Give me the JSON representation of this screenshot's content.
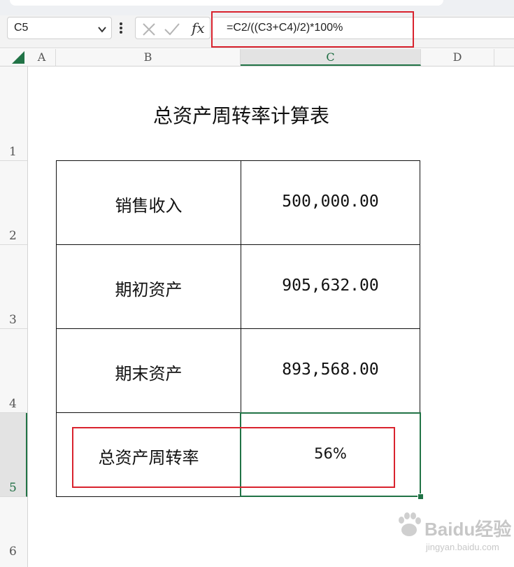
{
  "formula_bar": {
    "name_box": "C5",
    "fx_label": "fx",
    "formula": "=C2/((C3+C4)/2)*100%"
  },
  "columns": [
    "A",
    "B",
    "C",
    "D"
  ],
  "rows": [
    "1",
    "2",
    "3",
    "4",
    "5",
    "6"
  ],
  "sheet": {
    "title": "总资产周转率计算表",
    "table": [
      {
        "label": "销售收入",
        "value": "500,000.00"
      },
      {
        "label": "期初资产",
        "value": "905,632.00"
      },
      {
        "label": "期末资产",
        "value": "893,568.00"
      },
      {
        "label": "总资产周转率",
        "value": "56%"
      }
    ]
  },
  "watermark": {
    "brand": "Baidu经验",
    "url": "jingyan.baidu.com"
  },
  "colors": {
    "highlight": "#d9232e",
    "selection": "#217346"
  }
}
